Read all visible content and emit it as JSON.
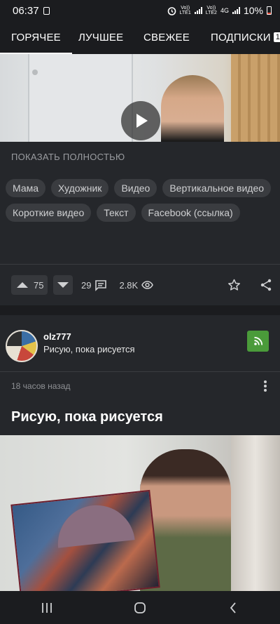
{
  "status_bar": {
    "time": "06:37",
    "sim1": "Vo))\nLTE1",
    "sim2": "Vo))\nLTE2",
    "network": "4G",
    "battery": "10%"
  },
  "tabs": [
    {
      "label": "ГОРЯЧЕЕ",
      "active": true
    },
    {
      "label": "ЛУЧШЕЕ",
      "active": false
    },
    {
      "label": "СВЕЖЕЕ",
      "active": false
    },
    {
      "label": "ПОДПИСКИ",
      "active": false,
      "badge": "1"
    }
  ],
  "post1": {
    "show_full": "ПОКАЗАТЬ ПОЛНОСТЬЮ",
    "tags": [
      "Мама",
      "Художник",
      "Видео",
      "Вертикальное видео",
      "Короткие видео",
      "Текст",
      "Facebook (ссылка)"
    ],
    "rating": "75",
    "comments": "29",
    "views": "2.8K"
  },
  "post2": {
    "username": "olz777",
    "user_subtitle": "Рисую, пока рисуется",
    "time_ago": "18 часов назад",
    "title": "Рисую, пока рисуется"
  },
  "icons": {
    "play": "play-icon",
    "comment": "comment-icon",
    "eye": "eye-icon",
    "star": "star-icon",
    "share": "share-icon",
    "rss": "rss-icon",
    "more": "more-vertical-icon"
  },
  "colors": {
    "background": "#25272b",
    "bar": "#1b1c1f",
    "tag_bg": "#3a3c40",
    "subscribe": "#4a9b3a"
  }
}
